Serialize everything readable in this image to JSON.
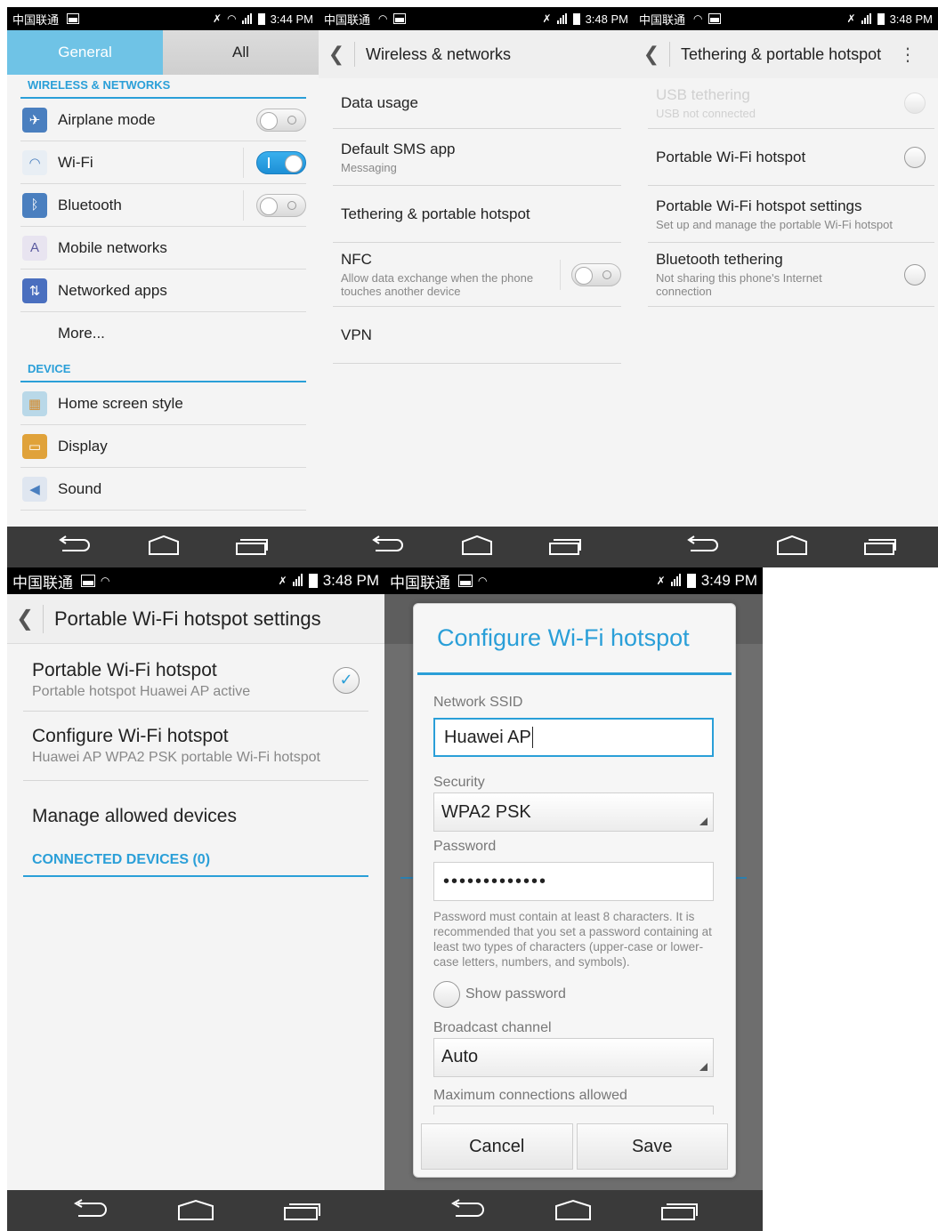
{
  "screen1": {
    "status": {
      "carrier": "中国联通",
      "time": "3:44 PM"
    },
    "tabs": [
      {
        "label": "General"
      },
      {
        "label": "All"
      }
    ],
    "sections": {
      "wireless": "WIRELESS & NETWORKS",
      "device": "DEVICE"
    },
    "wireless_items": [
      {
        "label": "Airplane mode",
        "toggle": "off",
        "icon": "airplane-icon"
      },
      {
        "label": "Wi-Fi",
        "toggle": "on",
        "icon": "wifi-icon"
      },
      {
        "label": "Bluetooth",
        "toggle": "off",
        "icon": "bluetooth-icon"
      },
      {
        "label": "Mobile networks",
        "icon": "antenna-icon"
      },
      {
        "label": "Networked apps",
        "icon": "network-apps-icon"
      },
      {
        "label": "More..."
      }
    ],
    "device_items": [
      {
        "label": "Home screen style",
        "icon": "home-screen-icon"
      },
      {
        "label": "Display",
        "icon": "display-icon"
      },
      {
        "label": "Sound",
        "icon": "sound-icon"
      }
    ]
  },
  "screen2": {
    "status": {
      "carrier": "中国联通",
      "time": "3:48 PM"
    },
    "title": "Wireless & networks",
    "items": {
      "data_usage": "Data usage",
      "sms_title": "Default SMS app",
      "sms_sub": "Messaging",
      "tethering": "Tethering & portable hotspot",
      "nfc_title": "NFC",
      "nfc_sub": "Allow data exchange when the phone touches another device",
      "vpn": "VPN"
    }
  },
  "screen3": {
    "status": {
      "carrier": "中国联通",
      "time": "3:48 PM"
    },
    "title": "Tethering & portable hotspot",
    "items": {
      "usb_title": "USB tethering",
      "usb_sub": "USB not connected",
      "hotspot_title": "Portable Wi-Fi hotspot",
      "settings_title": "Portable Wi-Fi hotspot settings",
      "settings_sub": "Set up and manage the portable Wi-Fi hotspot",
      "bt_title": "Bluetooth tethering",
      "bt_sub": "Not sharing this phone's Internet connection"
    }
  },
  "screen4": {
    "status": {
      "carrier": "中国联通",
      "time": "3:48 PM"
    },
    "title": "Portable Wi-Fi hotspot settings",
    "items": {
      "hotspot_title": "Portable Wi-Fi hotspot",
      "hotspot_sub": "Portable hotspot Huawei AP active",
      "config_title": "Configure Wi-Fi hotspot",
      "config_sub": "Huawei AP WPA2 PSK portable Wi-Fi hotspot",
      "manage": "Manage allowed devices",
      "connected": "CONNECTED DEVICES (0)"
    }
  },
  "screen5": {
    "status": {
      "carrier": "中国联通",
      "time": "3:49 PM"
    },
    "dialog": {
      "title": "Configure Wi-Fi hotspot",
      "ssid_label": "Network SSID",
      "ssid_value": "Huawei AP",
      "security_label": "Security",
      "security_value": "WPA2 PSK",
      "password_label": "Password",
      "password_value": "•••••••••••••",
      "password_hint": "Password must contain at least 8 characters. It is recommended that you set a password containing at least two types of characters (upper-case or lower-case letters, numbers, and symbols).",
      "show_password": "Show password",
      "channel_label": "Broadcast channel",
      "channel_value": "Auto",
      "max_label": "Maximum connections allowed",
      "cancel": "Cancel",
      "save": "Save"
    }
  },
  "colors": {
    "accent": "#2a9fd8",
    "tab_active": "#6fc3e6",
    "navbar": "#3a3a3a"
  }
}
